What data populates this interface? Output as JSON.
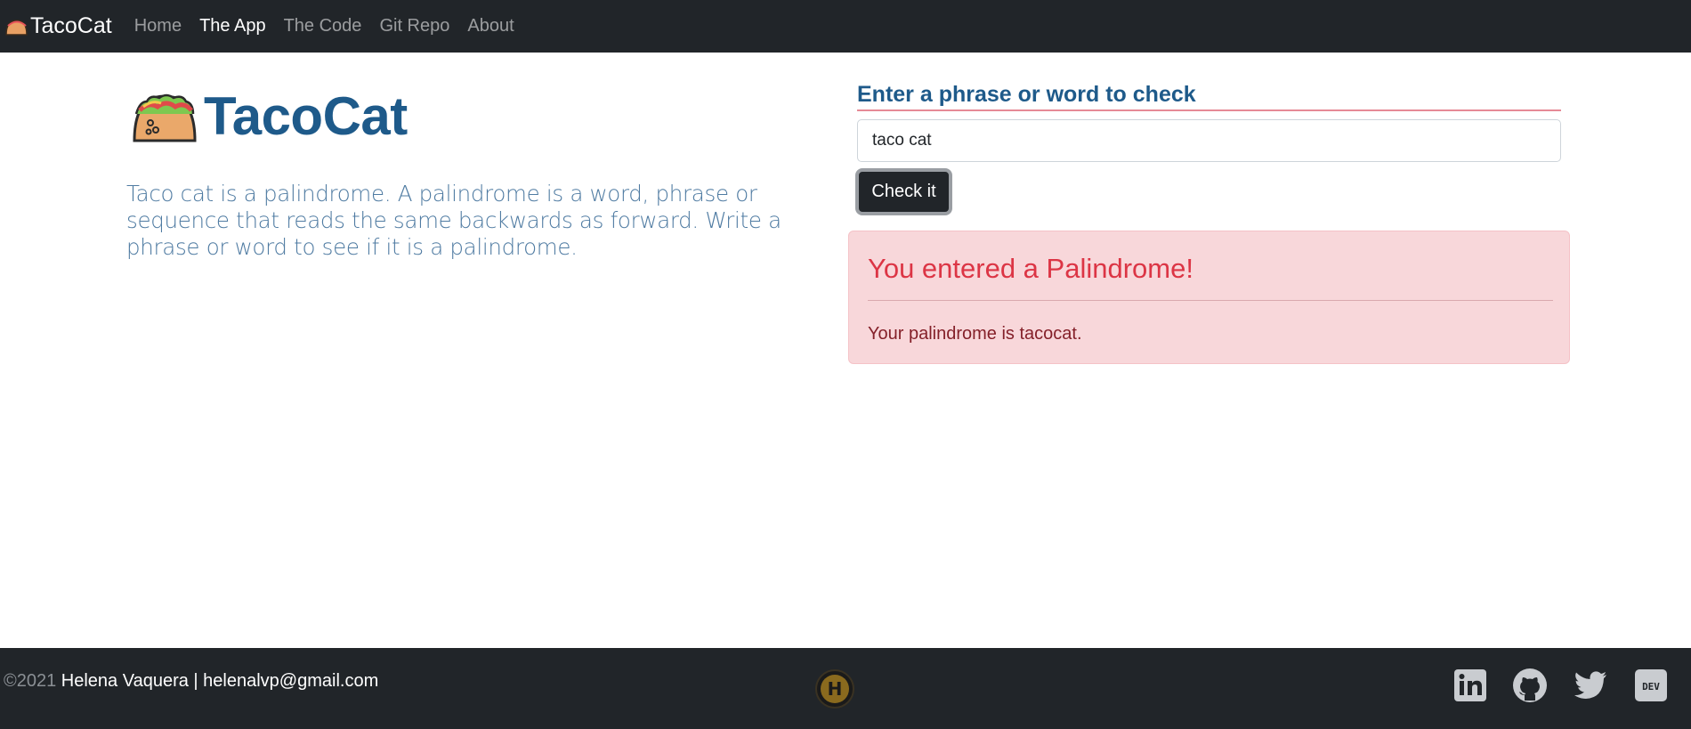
{
  "navbar": {
    "brand": "TacoCat",
    "links": [
      "Home",
      "The App",
      "The Code",
      "Git Repo",
      "About"
    ],
    "active": "The App"
  },
  "hero": {
    "title": "TacoCat",
    "description": "Taco cat is a palindrome. A palindrome is a word, phrase or sequence that reads the same backwards as forward. Write a phrase or word to see if it is a palindrome."
  },
  "form": {
    "label": "Enter a phrase or word to check",
    "input_value": "taco cat",
    "button_label": "Check it"
  },
  "result": {
    "heading": "You entered a Palindrome!",
    "message": "Your palindrome is tacocat."
  },
  "footer": {
    "year": "©2021",
    "author": " Helena Vaquera | helenalvp@gmail.com",
    "logo_letter": "H",
    "social_icons": [
      "linkedin-icon",
      "github-icon",
      "twitter-icon",
      "dev-icon"
    ]
  },
  "colors": {
    "navbar_bg": "#212529",
    "title_blue": "#1e5a8a",
    "alert_bg": "#f8d7da",
    "alert_heading": "#dc3545"
  }
}
